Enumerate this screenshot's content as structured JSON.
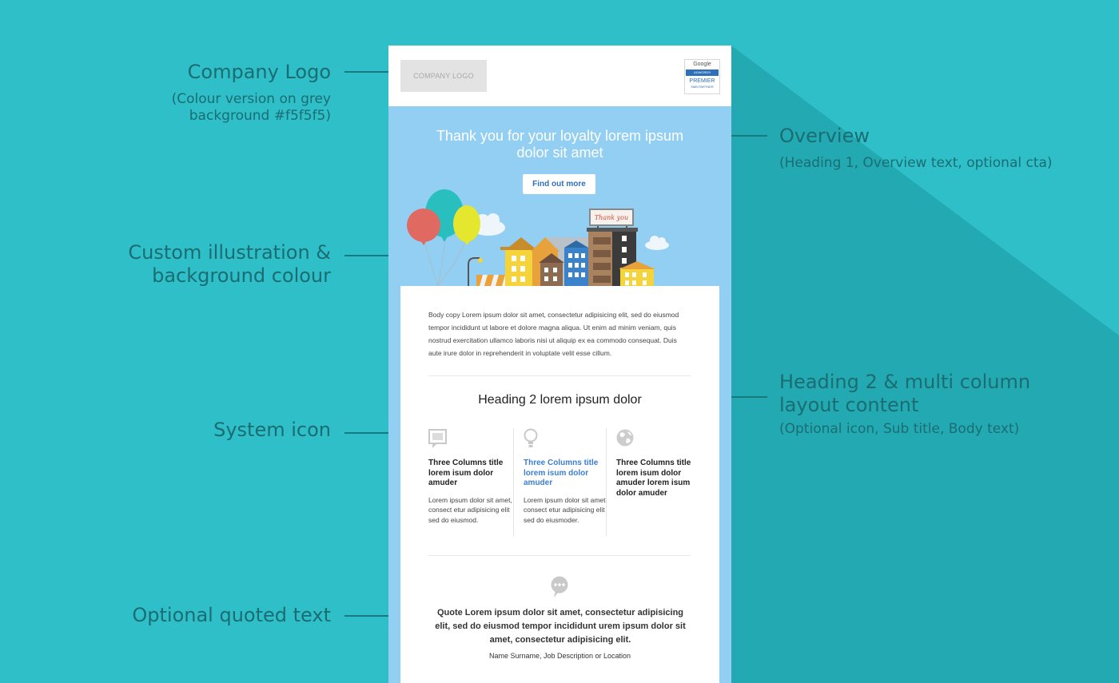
{
  "annotations": {
    "company_logo": {
      "title": "Company Logo",
      "sub": "(Colour version on grey background #f5f5f5)"
    },
    "overview": {
      "title": "Overview",
      "sub": "(Heading 1, Overview text, optional cta)"
    },
    "illustration": {
      "title": "Custom illustration & background colour"
    },
    "heading2": {
      "title": "Heading 2 & multi column layout content",
      "sub": "(Optional icon, Sub title, Body text)"
    },
    "system_icon": {
      "title": "System icon"
    },
    "quote": {
      "title": "Optional quoted text"
    }
  },
  "email": {
    "logo_placeholder": "COMPANY LOGO",
    "partner_badge": {
      "google": "Google",
      "product": "ADWORDS",
      "tier": "PREMIER",
      "program": "SMB PARTNER"
    },
    "hero": {
      "title": "Thank you for your loyalty lorem ipsum dolor sit amet",
      "cta": "Find out more",
      "billboard": "Thank you"
    },
    "body_copy": "Body copy Lorem ipsum dolor sit amet, consectetur adipisicing elit, sed do eiusmod tempor incididunt ut labore et dolore magna aliqua. Ut enim ad minim veniam, quis nostrud exercitation ullamco laboris nisi ut aliquip ex ea commodo consequat. Duis aute irure dolor in reprehenderit in voluptate velit esse cillum.",
    "heading2": "Heading 2 lorem ipsum dolor",
    "columns": [
      {
        "icon": "window-icon",
        "title": "Three Columns title lorem isum dolor amuder",
        "body": "Lorem ipsum dolor sit amet, consect etur adipisicing elit sed do eiusmod."
      },
      {
        "icon": "lightbulb-icon",
        "title": "Three Columns title lorem isum dolor amuder",
        "body": "Lorem ipsum dolor sit amet, consect etur adipisicing elit sed do eiusmoder."
      },
      {
        "icon": "globe-icon",
        "title": "Three Columns title lorem isum dolor amuder lorem isum dolor amuder",
        "body": ""
      }
    ],
    "quote": "Quote Lorem ipsum dolor sit amet, consectetur adipisicing elit, sed do eiusmod tempor incididunt urem ipsum dolor sit amet, consectetur adipisicing elit.",
    "attribution": "Name Surname,  Job Description or Location"
  },
  "colors": {
    "background": "#2ebfc8",
    "shadow": "#23a9b1",
    "hero": "#92cff2",
    "annotation": "#1b6d72",
    "link": "#3a7fd1"
  }
}
